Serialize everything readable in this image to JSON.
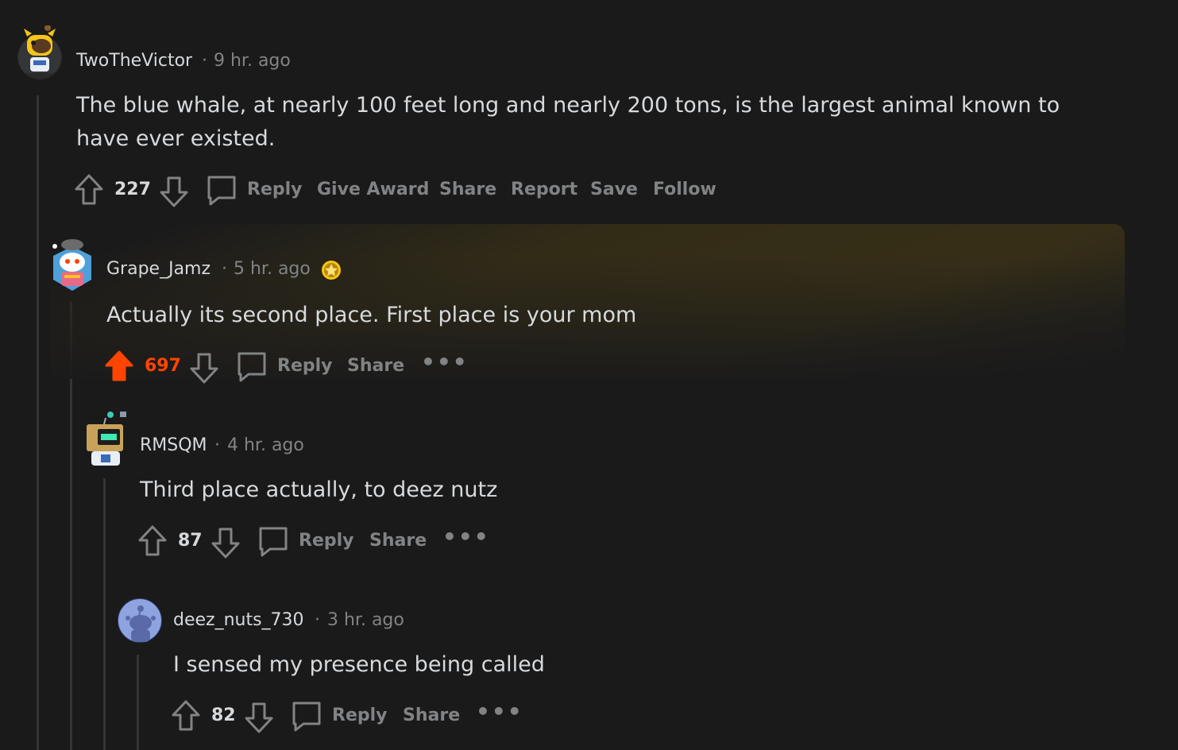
{
  "comments": [
    {
      "username": "TwoTheVictor",
      "time": "9 hr. ago",
      "body": "The blue whale, at nearly 100 feet long and nearly 200 tons, is the largest animal known to have ever existed.",
      "score": "227",
      "actions": [
        "Reply",
        "Give Award",
        "Share",
        "Report",
        "Save",
        "Follow"
      ]
    },
    {
      "username": "Grape_Jamz",
      "time": "5 hr. ago",
      "body": "Actually its second place. First place is your mom",
      "score": "697",
      "upvoted": true,
      "actions": [
        "Reply",
        "Share"
      ]
    },
    {
      "username": "RMSQM",
      "time": "4 hr. ago",
      "body": "Third place actually, to deez nutz",
      "score": "87",
      "actions": [
        "Reply",
        "Share"
      ]
    },
    {
      "username": "deez_nuts_730",
      "time": "3 hr. ago",
      "body": "I sensed my presence being called",
      "score": "82",
      "actions": [
        "Reply",
        "Share"
      ]
    }
  ],
  "separator": "·",
  "more_label": "•••",
  "colors": {
    "background": "#1a1a1b",
    "text": "#d7dadc",
    "muted": "#818384",
    "upvote": "#ff4500",
    "thread": "#343536"
  },
  "icons": [
    "upvote-icon",
    "downvote-icon",
    "comment-bubble-icon",
    "award-icon",
    "more-icon"
  ]
}
